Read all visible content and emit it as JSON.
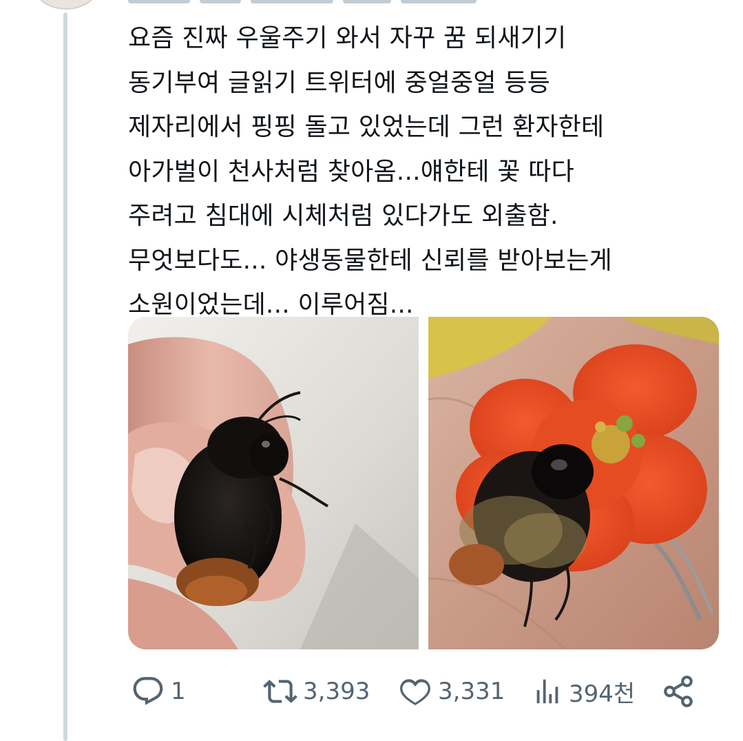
{
  "tweet": {
    "lines": [
      "요즘 진짜 우울주기 와서 자꾸 꿈 되새기기",
      "동기부여 글읽기 트위터에 중얼중얼 등등",
      "제자리에서 핑핑 돌고 있었는데 그런 환자한테",
      "아가벌이 천사처럼 찾아옴...얘한테 꽃 따다",
      "주려고 침대에 시체처럼 있다가도 외출함.",
      "무엇보다도... 야생동물한테 신뢰를 받아보는게",
      "소원이었는데... 이루어짐..."
    ]
  },
  "media": {
    "photos": [
      {
        "icon": "bee-on-finger-photo"
      },
      {
        "icon": "bee-on-red-flower-photo"
      }
    ]
  },
  "actions": {
    "reply_count": "1",
    "retweet_count": "3,393",
    "like_count": "3,331",
    "views_count": "394천"
  },
  "colors": {
    "icon_gray": "#536471",
    "thread_line": "#cfd9de",
    "text": "#0f1419"
  }
}
